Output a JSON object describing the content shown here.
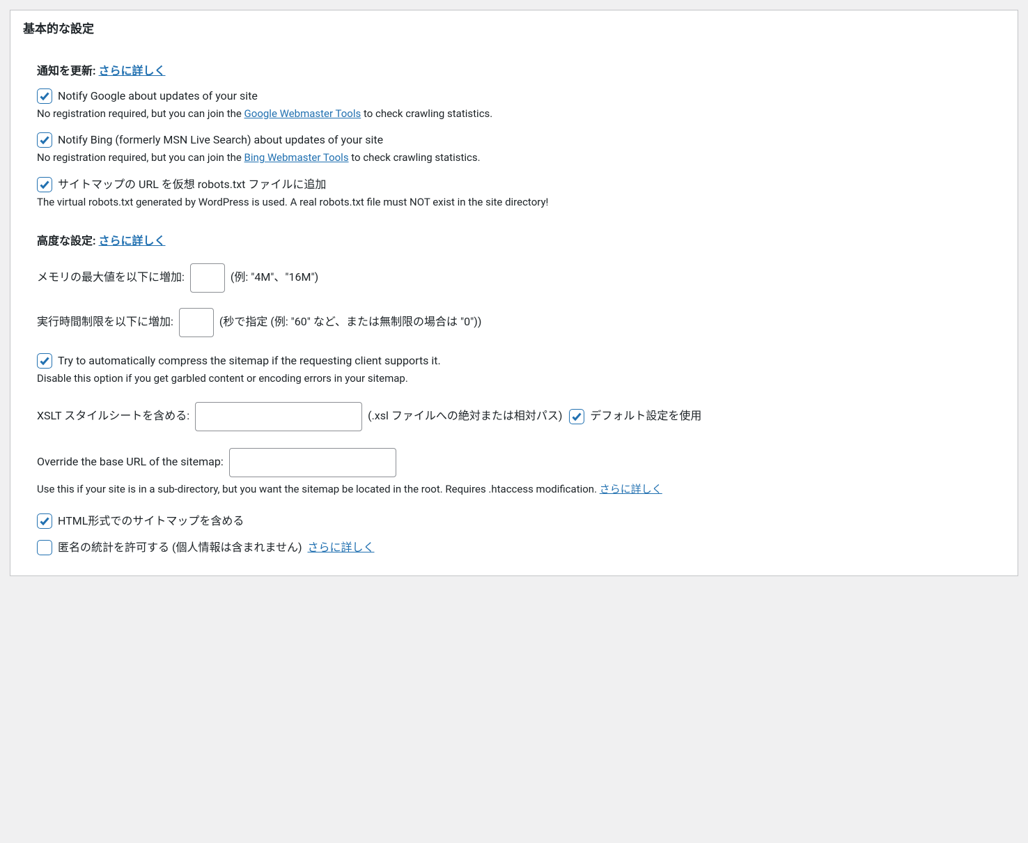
{
  "panel": {
    "title": "基本的な設定"
  },
  "notify": {
    "heading_label": "通知を更新:",
    "learn_more": "さらに詳しく",
    "google": {
      "label": "Notify Google about updates of your site",
      "desc_prefix": "No registration required, but you can join the ",
      "desc_link": "Google Webmaster Tools",
      "desc_suffix": " to check crawling statistics."
    },
    "bing": {
      "label": "Notify Bing (formerly MSN Live Search) about updates of your site",
      "desc_prefix": "No registration required, but you can join the ",
      "desc_link": "Bing Webmaster Tools",
      "desc_suffix": " to check crawling statistics."
    },
    "robots": {
      "label": "サイトマップの URL を仮想 robots.txt ファイルに追加",
      "desc": "The virtual robots.txt generated by WordPress is used. A real robots.txt file must NOT exist in the site directory!"
    }
  },
  "advanced": {
    "heading_label": "高度な設定:",
    "learn_more": "さらに詳しく",
    "memory": {
      "label": "メモリの最大値を以下に増加:",
      "value": "",
      "suffix": "(例: \"4M\"、\"16M\")"
    },
    "time": {
      "label": "実行時間制限を以下に増加:",
      "value": "",
      "suffix": "(秒で指定 (例: \"60\" など、または無制限の場合は \"0\"))"
    },
    "compress": {
      "label": "Try to automatically compress the sitemap if the requesting client supports it.",
      "desc": "Disable this option if you get garbled content or encoding errors in your sitemap."
    },
    "xslt": {
      "label": "XSLT スタイルシートを含める:",
      "value": "",
      "hint": "(.xsl ファイルへの絶対または相対パス)",
      "use_default_label": "デフォルト設定を使用"
    },
    "baseurl": {
      "label": "Override the base URL of the sitemap:",
      "value": "",
      "desc_prefix": "Use this if your site is in a sub-directory, but you want the sitemap be located in the root. Requires .htaccess modification. ",
      "desc_link": "さらに詳しく"
    },
    "html_sitemap": {
      "label": "HTML形式でのサイトマップを含める"
    },
    "anon_stats": {
      "label": "匿名の統計を許可する (個人情報は含まれません)",
      "link": "さらに詳しく"
    }
  }
}
